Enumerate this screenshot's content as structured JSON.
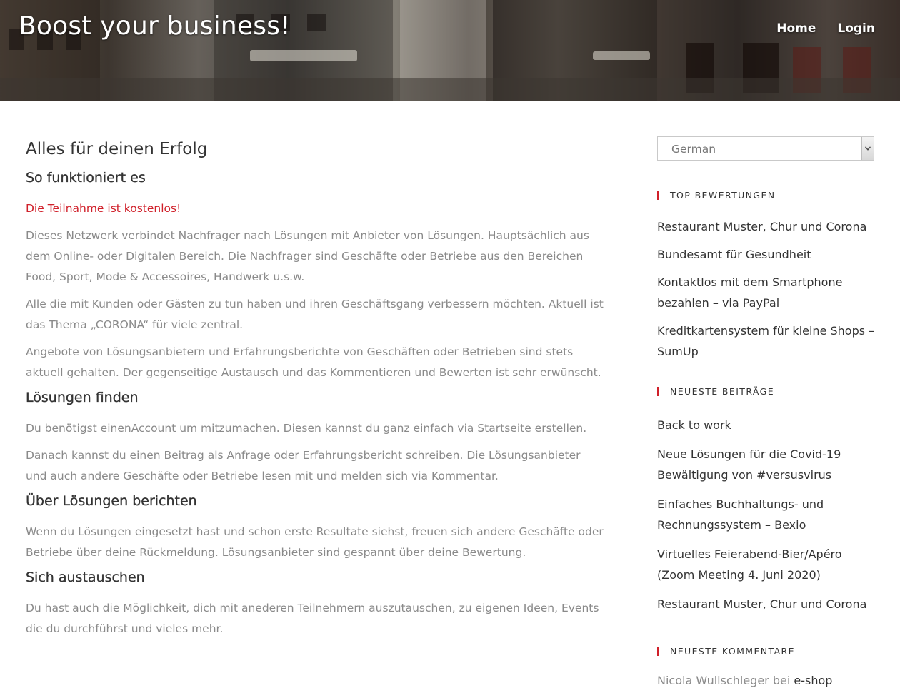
{
  "header": {
    "site_title": "Boost your business!",
    "nav": [
      {
        "label": "Home"
      },
      {
        "label": "Login"
      }
    ]
  },
  "main": {
    "page_title": "Alles für deinen Erfolg",
    "sections": [
      {
        "heading": "So funktioniert es",
        "highlight": "Die Teilnahme ist kostenlos!",
        "paragraphs": [
          "Dieses Netzwerk verbindet Nachfrager nach Lösungen mit Anbieter von Lösungen. Hauptsächlich aus dem Online- oder Digitalen Bereich. Die Nachfrager sind Geschäfte oder Betriebe aus den Bereichen Food, Sport, Mode & Accessoires, Handwerk u.s.w.",
          "Alle die mit Kunden oder Gästen zu tun haben und ihren Geschäftsgang verbessern möchten. Aktuell ist das Thema „CORONA“ für viele zentral.",
          "Angebote von Lösungsanbietern und Erfahrungsberichte von Geschäften oder Betrieben sind stets aktuell gehalten. Der gegenseitige Austausch und das Kommentieren und Bewerten ist sehr erwünscht."
        ]
      },
      {
        "heading": "Lösungen finden",
        "paragraphs": [
          "Du benötigst einenAccount um mitzumachen. Diesen kannst du ganz einfach via Startseite erstellen.",
          "Danach kannst du einen Beitrag als Anfrage oder Erfahrungsbericht schreiben. Die Lösungsanbieter und auch andere Geschäfte oder Betriebe lesen mit und melden sich via Kommentar."
        ]
      },
      {
        "heading": "Über Lösungen berichten",
        "paragraphs": [
          "Wenn du Lösungen eingesetzt hast und schon erste Resultate siehst, freuen sich andere Geschäfte oder Betriebe über deine Rückmeldung. Lösungsanbieter sind gespannt über deine Bewertung."
        ]
      },
      {
        "heading": "Sich austauschen",
        "paragraphs": [
          "Du hast auch die Möglichkeit, dich mit anederen Teilnehmern auszutauschen, zu eigenen Ideen, Events die du durchführst und vieles mehr."
        ]
      }
    ]
  },
  "sidebar": {
    "language_select": {
      "value": "German"
    },
    "top_ratings": {
      "title": "TOP BEWERTUNGEN",
      "items": [
        "Restaurant Muster, Chur und Corona",
        "Bundesamt für Gesundheit",
        "Kontaktlos mit dem Smartphone bezahlen – via PayPal",
        "Kreditkartensystem für kleine Shops – SumUp"
      ]
    },
    "recent_posts": {
      "title": "NEUESTE BEITRÄGE",
      "items": [
        "Back to work",
        "Neue Lösungen für die Covid-19 Bewältigung von #versusvirus",
        "Einfaches Buchhaltungs- und Rechnungssystem – Bexio",
        "Virtuelles Feierabend-Bier/Apéro (Zoom Meeting 4. Juni 2020)",
        "Restaurant Muster, Chur und Corona"
      ]
    },
    "recent_comments": {
      "title": "NEUESTE KOMMENTARE",
      "author": "Nicola Wullschleger",
      "connector": "bei",
      "post": "e-shop"
    }
  },
  "colors": {
    "accent": "#d0202a",
    "body_text": "#8a8a8a",
    "heading_text": "#333333"
  }
}
